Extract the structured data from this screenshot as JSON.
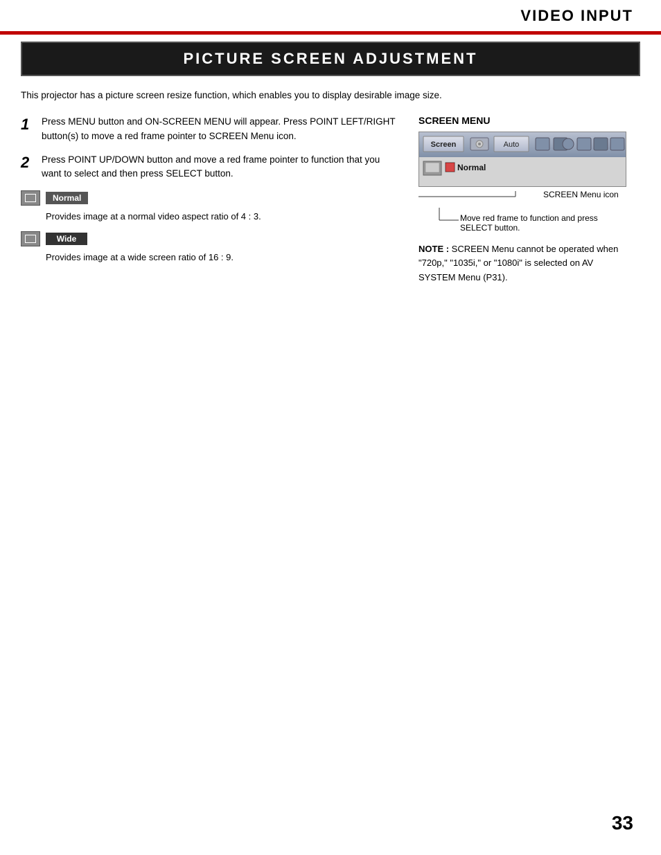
{
  "header": {
    "title": "VIDEO INPUT",
    "accent_color": "#c00000"
  },
  "section": {
    "banner": "PICTURE SCREEN ADJUSTMENT",
    "intro": "This projector has a picture screen resize function, which enables you to display desirable image size."
  },
  "steps": [
    {
      "number": "1",
      "text": "Press MENU button and ON-SCREEN MENU will appear.  Press POINT LEFT/RIGHT button(s) to move a red frame pointer to SCREEN Menu icon."
    },
    {
      "number": "2",
      "text": "Press POINT UP/DOWN button and move a red frame pointer to function that you want to select and then press SELECT button."
    }
  ],
  "options": [
    {
      "label": "Normal",
      "class": "normal",
      "description": "Provides image at a normal video aspect ratio of 4 : 3."
    },
    {
      "label": "Wide",
      "class": "wide",
      "description": "Provides image at a wide screen ratio of 16 : 9."
    }
  ],
  "screen_menu": {
    "title": "SCREEN MENU",
    "tab_screen": "Screen",
    "tab_auto": "Auto",
    "normal_label": "Normal",
    "icon_label": "SCREEN Menu icon",
    "arrow_text_line1": "Move red frame to function and press",
    "arrow_text_line2": "SELECT button."
  },
  "note": {
    "label": "NOTE :",
    "text": " SCREEN Menu cannot be operated when \"720p,\" \"1035i,\" or \"1080i\" is selected on AV SYSTEM Menu (P31)."
  },
  "page_number": "33"
}
